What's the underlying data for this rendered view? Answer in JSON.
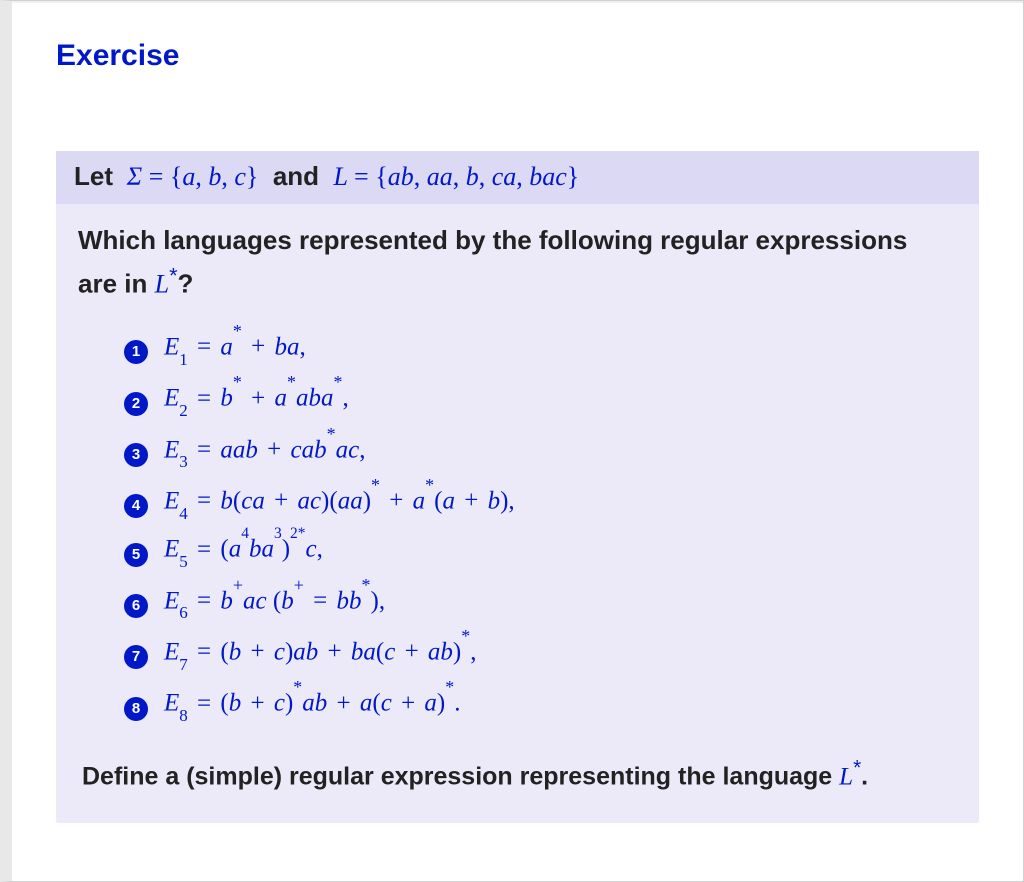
{
  "title": "Exercise",
  "header": {
    "let_label": "Let",
    "sigma_eq": "Σ = {a, b, c}",
    "and_label": "and",
    "L_eq": "L = {ab, aa, b, ca, bac}"
  },
  "question": {
    "line1": "Which languages represented by the following regular expressions",
    "line2a": "are in ",
    "line2b": "?"
  },
  "items": [
    {
      "n": "1",
      "html": "E<sub>1</sub> <span class='op'>=</span> a<sup>*</sup> <span class='op'>+</span> ba<span class='paren'>,</span>"
    },
    {
      "n": "2",
      "html": "E<sub>2</sub> <span class='op'>=</span> b<sup>*</sup> <span class='op'>+</span> a<sup>*</sup>aba<sup>*</sup><span class='paren'>,</span>"
    },
    {
      "n": "3",
      "html": "E<sub>3</sub> <span class='op'>=</span> aab <span class='op'>+</span> cab<sup>*</sup>ac<span class='paren'>,</span>"
    },
    {
      "n": "4",
      "html": "E<sub>4</sub> <span class='op'>=</span> b<span class='paren'>(</span>ca <span class='op'>+</span> ac<span class='paren'>)(</span>aa<span class='paren'>)</span><sup>*</sup> <span class='op'>+</span> a<sup>*</sup><span class='paren'>(</span>a <span class='op'>+</span> b<span class='paren'>)</span><span class='paren'>,</span>"
    },
    {
      "n": "5",
      "html": "E<sub>5</sub> <span class='op'>=</span> <span class='paren'>(</span>a<sup class='tight'>4</sup>ba<sup class='tight'>3</sup><span class='paren'>)</span><sup class='tight'>2*</sup>c<span class='paren'>,</span>"
    },
    {
      "n": "6",
      "html": "E<sub>6</sub> <span class='op'>=</span> b<sup>+</sup>ac <span class='paren'>(</span>b<sup>+</sup> <span class='op'>=</span> bb<sup>*</sup><span class='paren'>)</span><span class='paren'>,</span>"
    },
    {
      "n": "7",
      "html": "E<sub>7</sub> <span class='op'>=</span> <span class='paren'>(</span>b <span class='op'>+</span> c<span class='paren'>)</span>ab <span class='op'>+</span> ba<span class='paren'>(</span>c <span class='op'>+</span> ab<span class='paren'>)</span><sup>*</sup><span class='paren'>,</span>"
    },
    {
      "n": "8",
      "html": "E<sub>8</sub> <span class='op'>=</span> <span class='paren'>(</span>b <span class='op'>+</span> c<span class='paren'>)</span><sup>*</sup>ab <span class='op'>+</span> a<span class='paren'>(</span>c <span class='op'>+</span> a<span class='paren'>)</span><sup>*</sup><span class='paren'>.</span>"
    }
  ],
  "define": {
    "prefix": "Define a (simple) regular expression representing the language ",
    "suffix": "."
  }
}
